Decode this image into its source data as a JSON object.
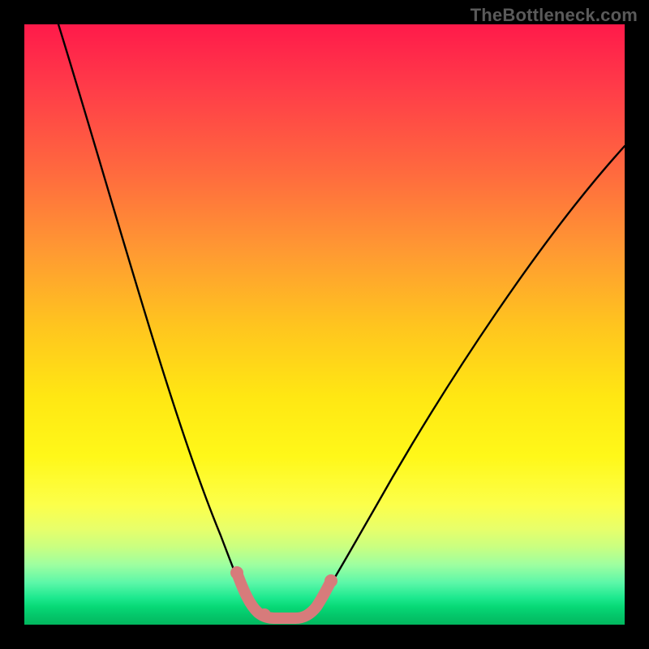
{
  "watermark": "TheBottleneck.com",
  "chart_data": {
    "type": "line",
    "title": "",
    "xlabel": "",
    "ylabel": "",
    "xlim": [
      0,
      100
    ],
    "ylim": [
      0,
      100
    ],
    "series": [
      {
        "name": "bottleneck-curve",
        "x": [
          0,
          5,
          10,
          15,
          20,
          25,
          28,
          31,
          33,
          35,
          37,
          39,
          41,
          43,
          45,
          47,
          50,
          55,
          60,
          65,
          70,
          75,
          80,
          85,
          90,
          95,
          100
        ],
        "values": [
          100,
          89,
          78,
          67,
          55,
          42,
          33,
          24,
          17,
          11,
          6,
          3,
          1,
          0.5,
          0.5,
          1,
          3,
          8,
          15,
          23,
          31,
          39,
          47,
          55,
          63,
          71,
          79
        ]
      }
    ],
    "highlight_region": {
      "name": "optimal-zone",
      "x_start": 35,
      "x_end": 48,
      "color": "#d77b7b"
    },
    "background": {
      "name": "heat-gradient",
      "stops": [
        {
          "pos": 0,
          "color": "#ff1a4a"
        },
        {
          "pos": 50,
          "color": "#ffc41f"
        },
        {
          "pos": 80,
          "color": "#fcff4a"
        },
        {
          "pos": 100,
          "color": "#02b85f"
        }
      ]
    }
  }
}
